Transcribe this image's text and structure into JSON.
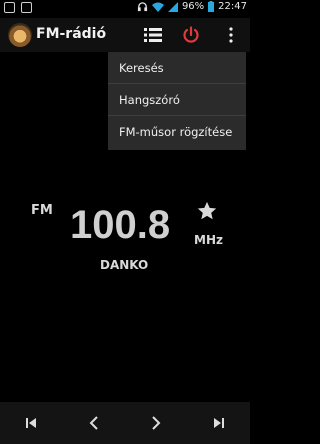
{
  "status_bar": {
    "battery_percent": "96%",
    "time": "22:47",
    "icons": [
      "notification-icon",
      "image-icon",
      "headphones-icon",
      "wifi-icon",
      "signal-icon",
      "battery-icon"
    ]
  },
  "action_bar": {
    "title": "FM-rádió",
    "icons": [
      "radio-app-icon",
      "list-icon",
      "power-icon",
      "overflow-menu-icon"
    ],
    "power_color": "#e03a3a"
  },
  "menu": {
    "items": [
      {
        "label": "Keresés"
      },
      {
        "label": "Hangszóró"
      },
      {
        "label": "FM-műsor rögzítése"
      }
    ]
  },
  "tuner": {
    "band": "FM",
    "frequency": "100.8",
    "unit": "MHz",
    "station": "DANKO",
    "favorite_icon": "star-icon"
  },
  "controls": {
    "icons": [
      "seek-previous-icon",
      "step-back-icon",
      "step-forward-icon",
      "seek-next-icon"
    ]
  }
}
